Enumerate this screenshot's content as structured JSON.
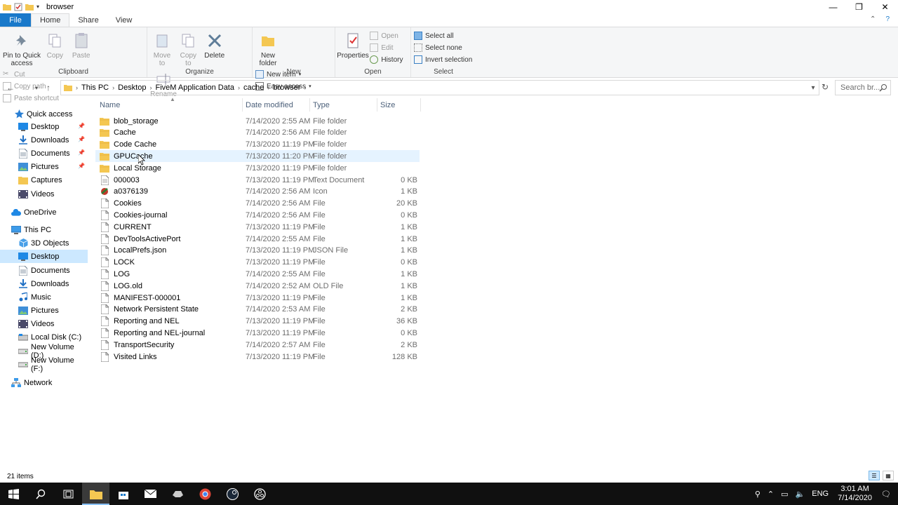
{
  "window": {
    "title": "browser",
    "minimize": "—",
    "restore": "❐",
    "close": "✕"
  },
  "tabs": {
    "file": "File",
    "home": "Home",
    "share": "Share",
    "view": "View",
    "collapse": "⌃",
    "help": "?"
  },
  "ribbon": {
    "clipboard": {
      "label": "Clipboard",
      "pin": "Pin to Quick access",
      "copy": "Copy",
      "paste": "Paste",
      "cut": "Cut",
      "copy_path": "Copy path",
      "paste_shortcut": "Paste shortcut"
    },
    "organize": {
      "label": "Organize",
      "move_to": "Move to",
      "copy_to": "Copy to",
      "delete": "Delete",
      "rename": "Rename"
    },
    "new": {
      "label": "New",
      "new_folder": "New folder",
      "new_item": "New item",
      "easy_access": "Easy access"
    },
    "open": {
      "label": "Open",
      "properties": "Properties",
      "open": "Open",
      "edit": "Edit",
      "history": "History"
    },
    "select": {
      "label": "Select",
      "select_all": "Select all",
      "select_none": "Select none",
      "invert": "Invert selection"
    }
  },
  "address": {
    "crumbs": [
      "This PC",
      "Desktop",
      "FiveM Application Data",
      "cache",
      "browser"
    ],
    "search_placeholder": "Search br..."
  },
  "sidebar": {
    "items": [
      {
        "label": "Quick access",
        "icon": "star-icon",
        "pinned": false
      },
      {
        "label": "Desktop",
        "icon": "desktop-icon",
        "pinned": true
      },
      {
        "label": "Downloads",
        "icon": "download-icon",
        "pinned": true
      },
      {
        "label": "Documents",
        "icon": "documents-icon",
        "pinned": true
      },
      {
        "label": "Pictures",
        "icon": "pictures-icon",
        "pinned": true
      },
      {
        "label": "Captures",
        "icon": "folder-icon",
        "pinned": false
      },
      {
        "label": "Videos",
        "icon": "videos-icon",
        "pinned": false
      },
      {
        "label": "OneDrive",
        "icon": "cloud-icon",
        "pinned": false
      },
      {
        "label": "This PC",
        "icon": "computer-icon",
        "pinned": false
      },
      {
        "label": "3D Objects",
        "icon": "cube-icon",
        "pinned": false
      },
      {
        "label": "Desktop",
        "icon": "desktop-icon",
        "pinned": false
      },
      {
        "label": "Documents",
        "icon": "documents-icon",
        "pinned": false
      },
      {
        "label": "Downloads",
        "icon": "download-icon",
        "pinned": false
      },
      {
        "label": "Music",
        "icon": "music-icon",
        "pinned": false
      },
      {
        "label": "Pictures",
        "icon": "pictures-icon",
        "pinned": false
      },
      {
        "label": "Videos",
        "icon": "videos-icon",
        "pinned": false
      },
      {
        "label": "Local Disk (C:)",
        "icon": "disk-icon",
        "pinned": false
      },
      {
        "label": "New Volume (D:)",
        "icon": "drive-icon",
        "pinned": false
      },
      {
        "label": "New Volume (F:)",
        "icon": "drive-icon",
        "pinned": false
      },
      {
        "label": "Network",
        "icon": "network-icon",
        "pinned": false
      }
    ]
  },
  "columns": {
    "name": "Name",
    "date": "Date modified",
    "type": "Type",
    "size": "Size"
  },
  "files": [
    {
      "name": "blob_storage",
      "date": "7/14/2020 2:55 AM",
      "type": "File folder",
      "size": "",
      "kind": "folder"
    },
    {
      "name": "Cache",
      "date": "7/14/2020 2:56 AM",
      "type": "File folder",
      "size": "",
      "kind": "folder"
    },
    {
      "name": "Code Cache",
      "date": "7/13/2020 11:19 PM",
      "type": "File folder",
      "size": "",
      "kind": "folder"
    },
    {
      "name": "GPUCache",
      "date": "7/13/2020 11:20 PM",
      "type": "File folder",
      "size": "",
      "kind": "folder"
    },
    {
      "name": "Local Storage",
      "date": "7/13/2020 11:19 PM",
      "type": "File folder",
      "size": "",
      "kind": "folder"
    },
    {
      "name": "000003",
      "date": "7/13/2020 11:19 PM",
      "type": "Text Document",
      "size": "0 KB",
      "kind": "text"
    },
    {
      "name": "a0376139",
      "date": "7/14/2020 2:56 AM",
      "type": "Icon",
      "size": "1 KB",
      "kind": "icon"
    },
    {
      "name": "Cookies",
      "date": "7/14/2020 2:56 AM",
      "type": "File",
      "size": "20 KB",
      "kind": "file"
    },
    {
      "name": "Cookies-journal",
      "date": "7/14/2020 2:56 AM",
      "type": "File",
      "size": "0 KB",
      "kind": "file"
    },
    {
      "name": "CURRENT",
      "date": "7/13/2020 11:19 PM",
      "type": "File",
      "size": "1 KB",
      "kind": "file"
    },
    {
      "name": "DevToolsActivePort",
      "date": "7/14/2020 2:55 AM",
      "type": "File",
      "size": "1 KB",
      "kind": "file"
    },
    {
      "name": "LocalPrefs.json",
      "date": "7/13/2020 11:19 PM",
      "type": "JSON File",
      "size": "1 KB",
      "kind": "file"
    },
    {
      "name": "LOCK",
      "date": "7/13/2020 11:19 PM",
      "type": "File",
      "size": "0 KB",
      "kind": "file"
    },
    {
      "name": "LOG",
      "date": "7/14/2020 2:55 AM",
      "type": "File",
      "size": "1 KB",
      "kind": "file"
    },
    {
      "name": "LOG.old",
      "date": "7/14/2020 2:52 AM",
      "type": "OLD File",
      "size": "1 KB",
      "kind": "file"
    },
    {
      "name": "MANIFEST-000001",
      "date": "7/13/2020 11:19 PM",
      "type": "File",
      "size": "1 KB",
      "kind": "file"
    },
    {
      "name": "Network Persistent State",
      "date": "7/14/2020 2:53 AM",
      "type": "File",
      "size": "2 KB",
      "kind": "file"
    },
    {
      "name": "Reporting and NEL",
      "date": "7/13/2020 11:19 PM",
      "type": "File",
      "size": "36 KB",
      "kind": "file"
    },
    {
      "name": "Reporting and NEL-journal",
      "date": "7/13/2020 11:19 PM",
      "type": "File",
      "size": "0 KB",
      "kind": "file"
    },
    {
      "name": "TransportSecurity",
      "date": "7/14/2020 2:57 AM",
      "type": "File",
      "size": "2 KB",
      "kind": "file"
    },
    {
      "name": "Visited Links",
      "date": "7/13/2020 11:19 PM",
      "type": "File",
      "size": "128 KB",
      "kind": "file"
    }
  ],
  "status": {
    "count": "21 items"
  },
  "taskbar": {
    "lang": "ENG",
    "time": "3:01 AM",
    "date": "7/14/2020"
  },
  "colors": {
    "accent": "#1979ca",
    "folder": "#f4c752",
    "selection": "#cce8ff",
    "hover": "#e5f3ff"
  }
}
